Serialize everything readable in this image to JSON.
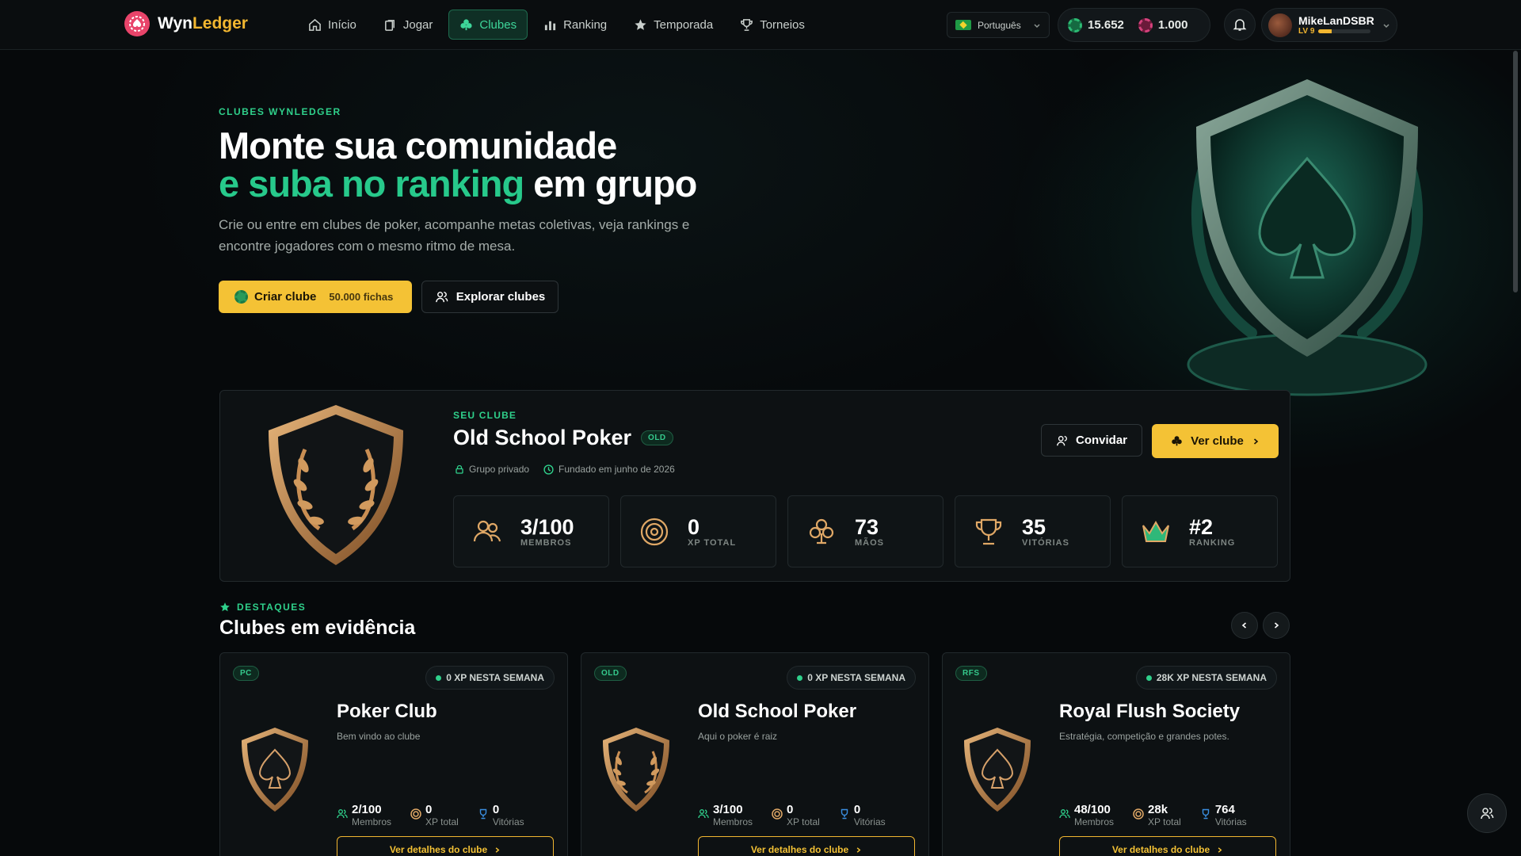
{
  "brand": {
    "name_part1": "Wyn",
    "name_part2": "Ledger"
  },
  "nav": {
    "items": [
      {
        "label": "Início",
        "icon": "home-icon"
      },
      {
        "label": "Jogar",
        "icon": "cards-icon"
      },
      {
        "label": "Clubes",
        "icon": "club-icon",
        "active": true
      },
      {
        "label": "Ranking",
        "icon": "bar-chart-icon"
      },
      {
        "label": "Temporada",
        "icon": "star-icon"
      },
      {
        "label": "Torneios",
        "icon": "trophy-icon"
      }
    ]
  },
  "language": {
    "label": "Português"
  },
  "wallet": {
    "chips": "15.652",
    "gems": "1.000"
  },
  "user": {
    "name": "MikeLanDSBR",
    "level": "LV 9",
    "xp_progress": 0.25
  },
  "hero": {
    "eyebrow": "CLUBES WYNLEDGER",
    "title_line1": "Monte sua comunidade",
    "title_line2_green": "e suba no ranking",
    "title_line2_rest": "em grupo",
    "subtitle": "Crie ou entre em clubes de poker, acompanhe metas coletivas, veja rankings e encontre jogadores com o mesmo ritmo de mesa.",
    "create_button": "Criar clube",
    "create_price": "50.000 fichas",
    "explore_button": "Explorar clubes"
  },
  "my_club": {
    "eyebrow": "SEU CLUBE",
    "name": "Old School Poker",
    "tag": "OLD",
    "privacy": "Grupo privado",
    "founded": "Fundado em junho de 2026",
    "invite_button": "Convidar",
    "view_button": "Ver clube",
    "stats": [
      {
        "value": "3/100",
        "label": "MEMBROS",
        "icon": "members-icon"
      },
      {
        "value": "0",
        "label": "XP TOTAL",
        "icon": "target-icon"
      },
      {
        "value": "73",
        "label": "MÃOS",
        "icon": "club-icon"
      },
      {
        "value": "35",
        "label": "VITÓRIAS",
        "icon": "trophy-icon"
      },
      {
        "value": "#2",
        "label": "RANKING",
        "icon": "crown-icon"
      }
    ]
  },
  "featured": {
    "eyebrow": "DESTAQUES",
    "title": "Clubes em evidência",
    "cards": [
      {
        "tag": "PC",
        "xp_week": "0 XP NESTA SEMANA",
        "name": "Poker Club",
        "desc": "Bem vindo ao clube",
        "members": "2/100",
        "members_label": "Membros",
        "xp": "0",
        "xp_label": "XP total",
        "wins": "0",
        "wins_label": "Vitórias",
        "button": "Ver detalhes do clube",
        "emblem": "spade"
      },
      {
        "tag": "OLD",
        "xp_week": "0 XP NESTA SEMANA",
        "name": "Old School Poker",
        "desc": "Aqui o poker é raiz",
        "members": "3/100",
        "members_label": "Membros",
        "xp": "0",
        "xp_label": "XP total",
        "wins": "0",
        "wins_label": "Vitórias",
        "button": "Ver detalhes do clube",
        "emblem": "laurel"
      },
      {
        "tag": "RFS",
        "xp_week": "28K XP NESTA SEMANA",
        "name": "Royal Flush Society",
        "desc": "Estratégia, competição e grandes potes.",
        "members": "48/100",
        "members_label": "Membros",
        "xp": "28k",
        "xp_label": "XP total",
        "wins": "764",
        "wins_label": "Vitórias",
        "button": "Ver detalhes do clube",
        "emblem": "spade"
      }
    ]
  },
  "colors": {
    "accent_green": "#27c98b",
    "accent_gold": "#f4c235",
    "background": "#06090b"
  }
}
